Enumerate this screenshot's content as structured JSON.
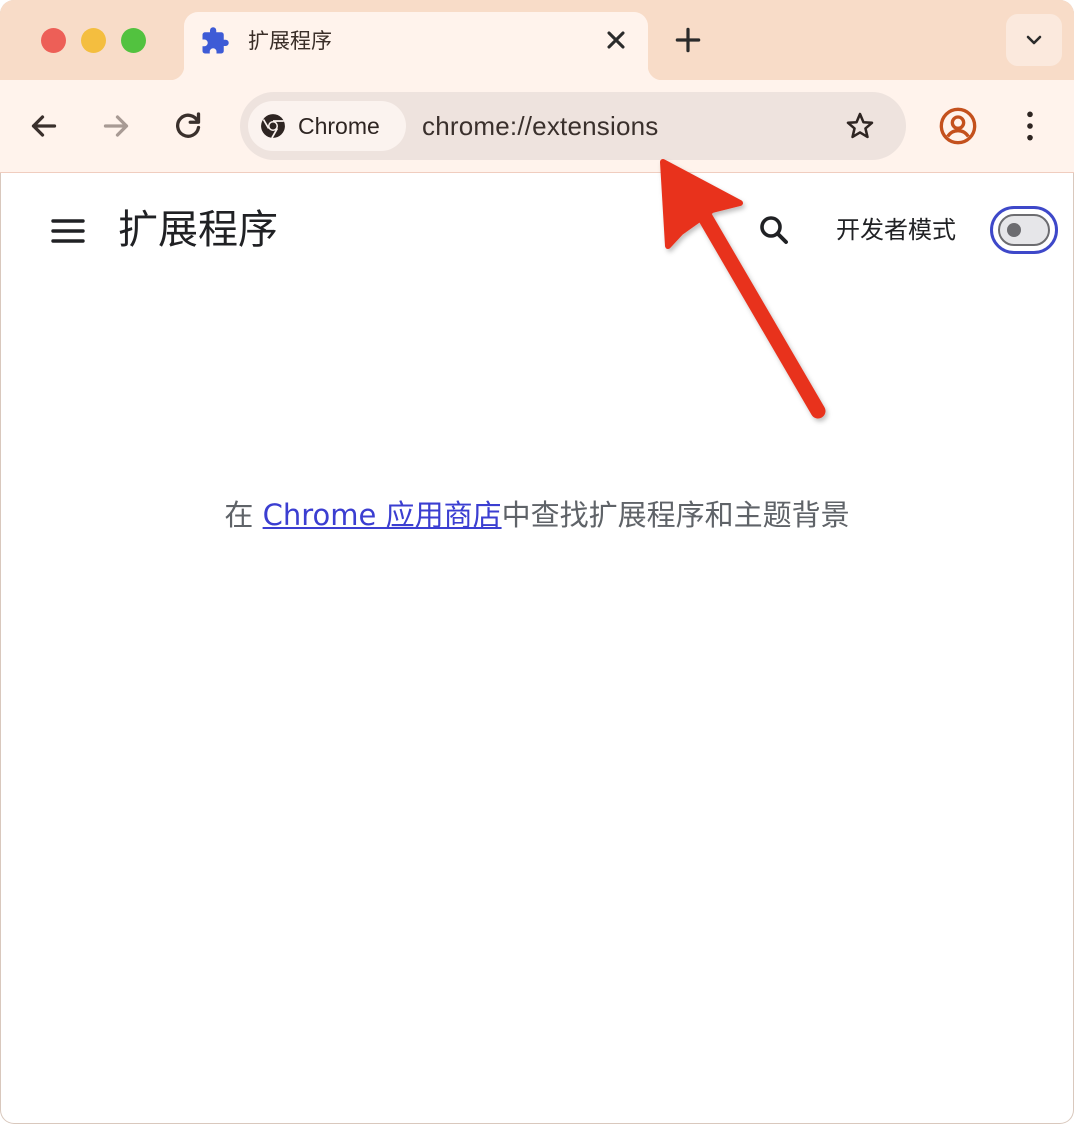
{
  "tab": {
    "title": "扩展程序",
    "icon": "puzzle-icon"
  },
  "omnibox": {
    "chip_label": "Chrome",
    "url": "chrome://extensions"
  },
  "page": {
    "title": "扩展程序",
    "dev_mode_label": "开发者模式",
    "dev_mode_enabled": false
  },
  "message": {
    "prefix": "在 ",
    "link": "Chrome 应用商店",
    "suffix": "中查找扩展程序和主题背景"
  },
  "colors": {
    "tabstrip": "#f8dcc8",
    "toolbar": "#fff3ec",
    "accent": "#3e48c9",
    "link": "#3b3ed1",
    "annotation_arrow": "#e8321f"
  }
}
